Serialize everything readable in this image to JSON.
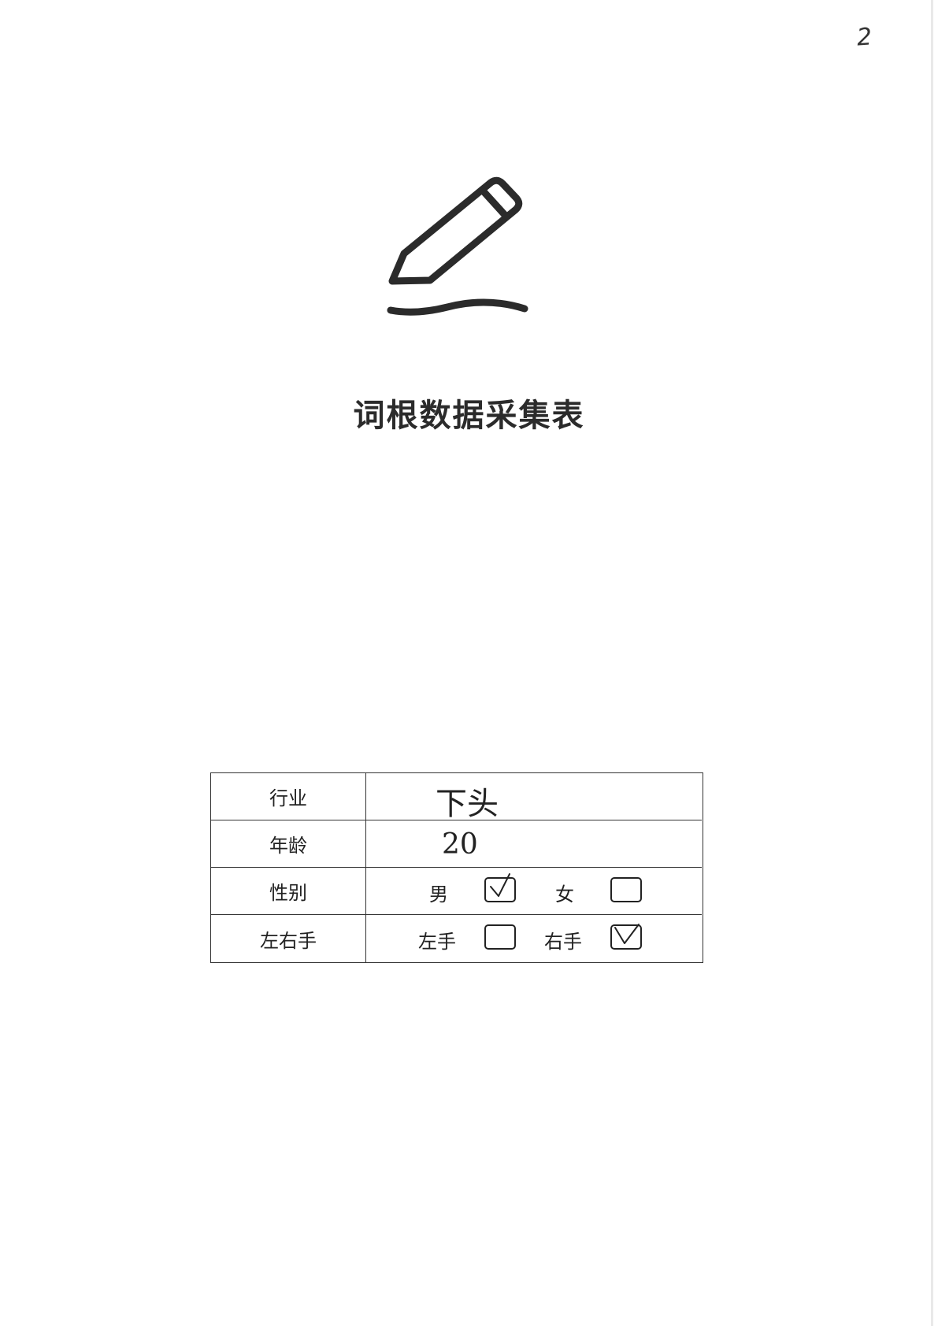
{
  "page": {
    "number": "2",
    "title": "词根数据采集表"
  },
  "form": {
    "industry": {
      "label": "行业",
      "value": "下头"
    },
    "age": {
      "label": "年龄",
      "value": "20"
    },
    "gender": {
      "label": "性别",
      "options": [
        {
          "label": "男",
          "checked": true
        },
        {
          "label": "女",
          "checked": false
        }
      ]
    },
    "handedness": {
      "label": "左右手",
      "options": [
        {
          "label": "左手",
          "checked": false
        },
        {
          "label": "右手",
          "checked": true
        }
      ]
    }
  },
  "icons": {
    "header_icon": "pencil-writing-icon"
  }
}
